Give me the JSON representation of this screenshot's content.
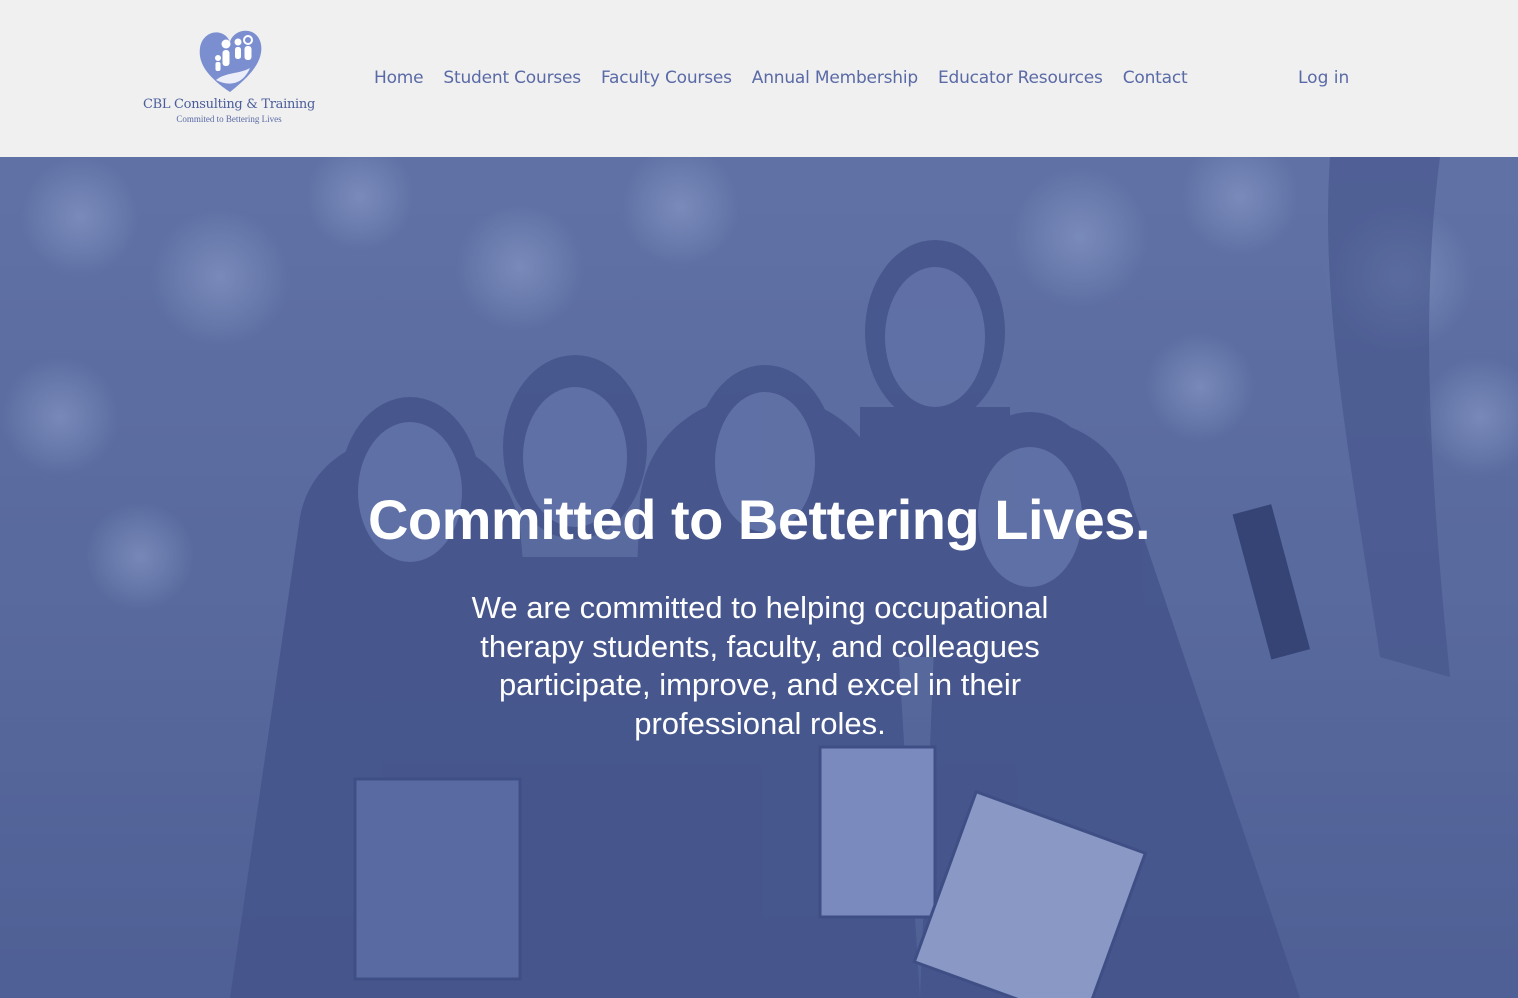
{
  "brand": {
    "name": "CBL Consulting & Training",
    "tagline": "Commited to Bettering Lives"
  },
  "nav": {
    "items": [
      {
        "label": "Home"
      },
      {
        "label": "Student Courses"
      },
      {
        "label": "Faculty Courses"
      },
      {
        "label": "Annual Membership"
      },
      {
        "label": "Educator Resources"
      },
      {
        "label": "Contact"
      }
    ],
    "login_label": "Log in"
  },
  "hero": {
    "title": "Committed to Bettering Lives.",
    "text": "We are committed to helping occupational therapy students, faculty, and colleagues participate, improve, and excel in their professional roles.",
    "image_icon": "group-of-students-photo"
  },
  "colors": {
    "header_bg": "#f0f0f0",
    "nav_text": "#5a6aa6",
    "hero_tint": "#5b6c9f",
    "hero_text": "#ffffff"
  }
}
